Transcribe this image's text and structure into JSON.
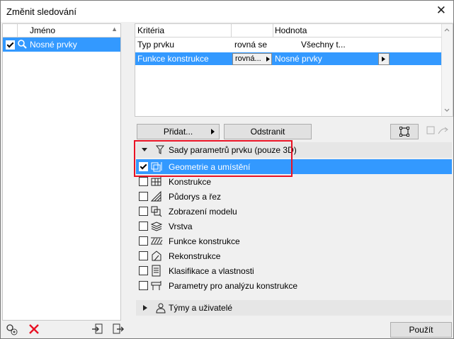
{
  "window": {
    "title": "Změnit sledování",
    "close_glyph": "✕"
  },
  "left_panel": {
    "column_name": "Jméno",
    "rows": [
      {
        "label": "Nosné prvky",
        "checked": true
      }
    ]
  },
  "criteria": {
    "col_criteria": "Kritéria",
    "col_value": "Hodnota",
    "rows": [
      {
        "criterion": "Typ prvku",
        "operator": "rovná se",
        "value": "Všechny t..."
      },
      {
        "criterion": "Funkce konstrukce",
        "operator": "rovná...",
        "value": "Nosné prvky"
      }
    ]
  },
  "buttons": {
    "add": "Přidat...",
    "remove": "Odstranit",
    "ok": "Použít"
  },
  "groups": {
    "params_title": "Sady parametrů prvku (pouze 3D)",
    "params_items": [
      {
        "label": "Geometrie a umístění",
        "checked": true,
        "icon": "geometry-icon"
      },
      {
        "label": "Konstrukce",
        "checked": false,
        "icon": "construction-icon"
      },
      {
        "label": "Půdorys a řez",
        "checked": false,
        "icon": "floorplan-section-icon"
      },
      {
        "label": "Zobrazení modelu",
        "checked": false,
        "icon": "model-display-icon"
      },
      {
        "label": "Vrstva",
        "checked": false,
        "icon": "layer-icon"
      },
      {
        "label": "Funkce konstrukce",
        "checked": false,
        "icon": "structural-function-icon"
      },
      {
        "label": "Rekonstrukce",
        "checked": false,
        "icon": "renovation-icon"
      },
      {
        "label": "Klasifikace a vlastnosti",
        "checked": false,
        "icon": "classification-icon"
      },
      {
        "label": "Parametry pro analýzu konstrukce",
        "checked": false,
        "icon": "analysis-icon"
      }
    ],
    "teams_title": "Týmy a uživatelé"
  },
  "colors": {
    "selection": "#3399ff",
    "highlight_frame": "#e81123",
    "delete_icon": "#e81123"
  }
}
